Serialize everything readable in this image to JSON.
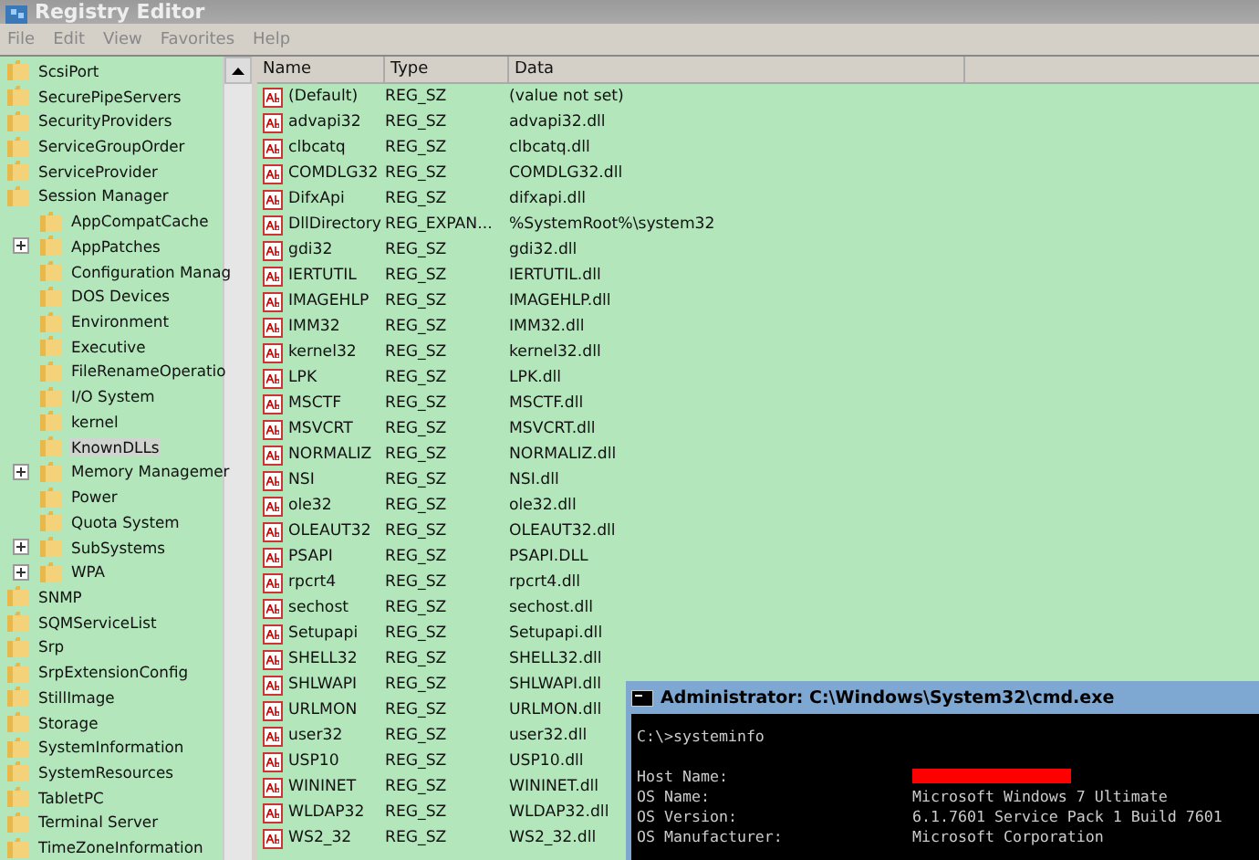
{
  "window": {
    "title": "Registry Editor"
  },
  "menu": [
    "File",
    "Edit",
    "View",
    "Favorites",
    "Help"
  ],
  "tree": [
    {
      "label": "ScsiPort",
      "selected": false
    },
    {
      "label": "SecurePipeServers",
      "selected": false
    },
    {
      "label": "SecurityProviders",
      "selected": false
    },
    {
      "label": "ServiceGroupOrder",
      "selected": false
    },
    {
      "label": "ServiceProvider",
      "selected": false
    },
    {
      "label": "Session Manager",
      "selected": false,
      "expanded": true,
      "children": [
        {
          "label": "AppCompatCache",
          "selected": false
        },
        {
          "label": "AppPatches",
          "selected": false,
          "expanded": false
        },
        {
          "label": "Configuration Manag",
          "selected": false
        },
        {
          "label": "DOS Devices",
          "selected": false
        },
        {
          "label": "Environment",
          "selected": false
        },
        {
          "label": "Executive",
          "selected": false
        },
        {
          "label": "FileRenameOperatio",
          "selected": false
        },
        {
          "label": "I/O System",
          "selected": false
        },
        {
          "label": "kernel",
          "selected": false
        },
        {
          "label": "KnownDLLs",
          "selected": true
        },
        {
          "label": "Memory Managemer",
          "selected": false,
          "expanded": false
        },
        {
          "label": "Power",
          "selected": false
        },
        {
          "label": "Quota System",
          "selected": false
        },
        {
          "label": "SubSystems",
          "selected": false,
          "expanded": false
        },
        {
          "label": "WPA",
          "selected": false,
          "expanded": false
        }
      ]
    },
    {
      "label": "SNMP",
      "selected": false
    },
    {
      "label": "SQMServiceList",
      "selected": false
    },
    {
      "label": "Srp",
      "selected": false
    },
    {
      "label": "SrpExtensionConfig",
      "selected": false
    },
    {
      "label": "StillImage",
      "selected": false
    },
    {
      "label": "Storage",
      "selected": false
    },
    {
      "label": "SystemInformation",
      "selected": false
    },
    {
      "label": "SystemResources",
      "selected": false
    },
    {
      "label": "TabletPC",
      "selected": false
    },
    {
      "label": "Terminal Server",
      "selected": false
    },
    {
      "label": "TimeZoneInformation",
      "selected": false
    }
  ],
  "table": {
    "columns": [
      "Name",
      "Type",
      "Data"
    ],
    "rows": [
      [
        "(Default)",
        "REG_SZ",
        "(value not set)"
      ],
      [
        "advapi32",
        "REG_SZ",
        "advapi32.dll"
      ],
      [
        "clbcatq",
        "REG_SZ",
        "clbcatq.dll"
      ],
      [
        "COMDLG32",
        "REG_SZ",
        "COMDLG32.dll"
      ],
      [
        "DifxApi",
        "REG_SZ",
        "difxapi.dll"
      ],
      [
        "DllDirectory",
        "REG_EXPAN...",
        "%SystemRoot%\\system32"
      ],
      [
        "gdi32",
        "REG_SZ",
        "gdi32.dll"
      ],
      [
        "IERTUTIL",
        "REG_SZ",
        "IERTUTIL.dll"
      ],
      [
        "IMAGEHLP",
        "REG_SZ",
        "IMAGEHLP.dll"
      ],
      [
        "IMM32",
        "REG_SZ",
        "IMM32.dll"
      ],
      [
        "kernel32",
        "REG_SZ",
        "kernel32.dll"
      ],
      [
        "LPK",
        "REG_SZ",
        "LPK.dll"
      ],
      [
        "MSCTF",
        "REG_SZ",
        "MSCTF.dll"
      ],
      [
        "MSVCRT",
        "REG_SZ",
        "MSVCRT.dll"
      ],
      [
        "NORMALIZ",
        "REG_SZ",
        "NORMALIZ.dll"
      ],
      [
        "NSI",
        "REG_SZ",
        "NSI.dll"
      ],
      [
        "ole32",
        "REG_SZ",
        "ole32.dll"
      ],
      [
        "OLEAUT32",
        "REG_SZ",
        "OLEAUT32.dll"
      ],
      [
        "PSAPI",
        "REG_SZ",
        "PSAPI.DLL"
      ],
      [
        "rpcrt4",
        "REG_SZ",
        "rpcrt4.dll"
      ],
      [
        "sechost",
        "REG_SZ",
        "sechost.dll"
      ],
      [
        "Setupapi",
        "REG_SZ",
        "Setupapi.dll"
      ],
      [
        "SHELL32",
        "REG_SZ",
        "SHELL32.dll"
      ],
      [
        "SHLWAPI",
        "REG_SZ",
        "SHLWAPI.dll"
      ],
      [
        "URLMON",
        "REG_SZ",
        "URLMON.dll"
      ],
      [
        "user32",
        "REG_SZ",
        "user32.dll"
      ],
      [
        "USP10",
        "REG_SZ",
        "USP10.dll"
      ],
      [
        "WININET",
        "REG_SZ",
        "WININET.dll"
      ],
      [
        "WLDAP32",
        "REG_SZ",
        "WLDAP32.dll"
      ],
      [
        "WS2_32",
        "REG_SZ",
        "WS2_32.dll"
      ]
    ]
  },
  "console": {
    "title": "Administrator: C:\\Windows\\System32\\cmd.exe",
    "command": "C:\\>systeminfo",
    "lines": [
      {
        "key": "Host Name:",
        "redacted": true
      },
      {
        "key": "OS Name:",
        "value": "Microsoft Windows 7 Ultimate"
      },
      {
        "key": "OS Version:",
        "value": "6.1.7601 Service Pack 1 Build 7601"
      },
      {
        "key": "OS Manufacturer:",
        "value": "Microsoft Corporation"
      }
    ]
  }
}
